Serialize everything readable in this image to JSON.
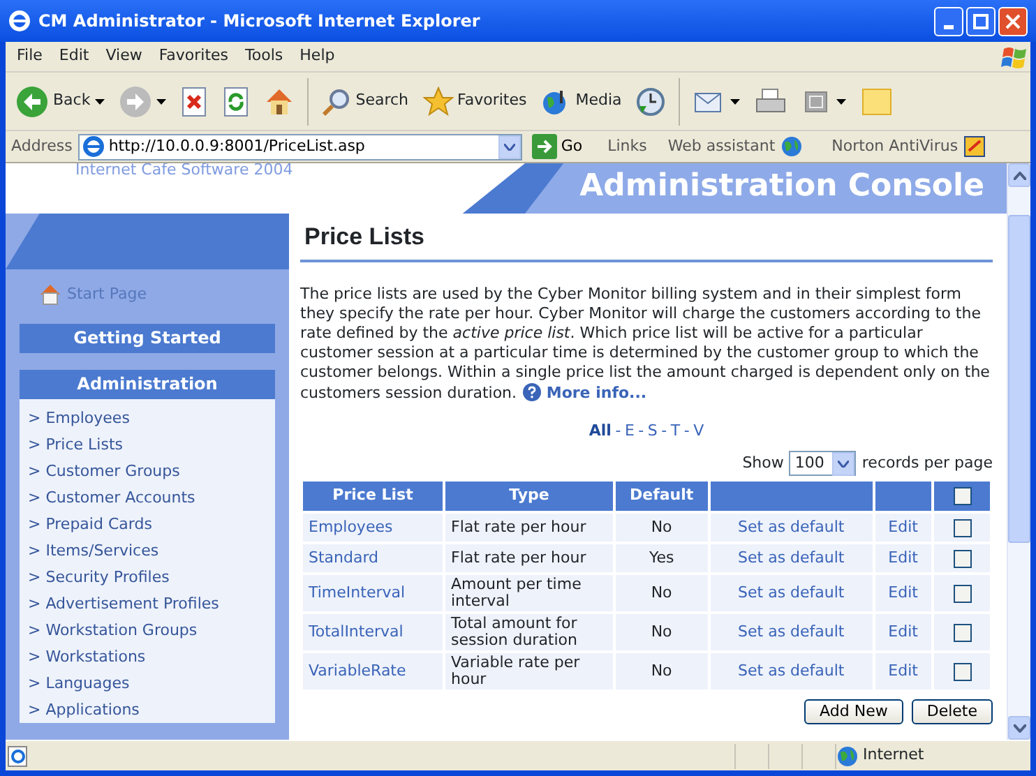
{
  "window": {
    "title": "CM Administrator - Microsoft Internet Explorer"
  },
  "menu_bar": [
    "File",
    "Edit",
    "View",
    "Favorites",
    "Tools",
    "Help"
  ],
  "toolbar": {
    "back": "Back",
    "search": "Search",
    "favorites": "Favorites",
    "media": "Media"
  },
  "address_bar": {
    "label": "Address",
    "url": "http://10.0.0.9:8001/PriceList.asp",
    "go": "Go",
    "links": "Links",
    "web_assistant": "Web assistant",
    "antivirus": "Norton AntiVirus"
  },
  "header": {
    "logo_caption": "Internet Cafe Software 2004",
    "title": "Administration Console"
  },
  "sidebar": {
    "start_page": "Start Page",
    "sections": [
      {
        "title": "Getting Started"
      },
      {
        "title": "Administration",
        "items": [
          "> Employees",
          "> Price Lists",
          "> Customer Groups",
          "> Customer Accounts",
          "> Prepaid Cards",
          "> Items/Services",
          "> Security Profiles",
          "> Advertisement Profiles",
          "> Workstation Groups",
          "> Workstations",
          "> Languages",
          "> Applications"
        ]
      }
    ]
  },
  "page": {
    "title": "Price Lists",
    "description": "The price lists are used by the Cyber Monitor billing system and in their simplest form they specify the rate per hour. Cyber Monitor will charge the customers according to the rate defined by the *active price list*. Which price list will be active for a particular customer session at a particular time is determined by the customer group to which the customer belongs. Within a single price list the amount charged is dependent only on the customers session duration.",
    "more_info": "More info...",
    "letter_filter": [
      {
        "label": "All",
        "selected": true
      },
      {
        "label": "E",
        "selected": false
      },
      {
        "label": "S",
        "selected": false
      },
      {
        "label": "T",
        "selected": false
      },
      {
        "label": "V",
        "selected": false
      }
    ],
    "filter_separator": "-",
    "show_label": "Show",
    "page_size": "100",
    "per_page_label": "records per page",
    "table": {
      "columns": [
        "Price List",
        "Type",
        "Default"
      ],
      "select_all_checked": false,
      "rows": [
        {
          "name": "Employees",
          "type": "Flat rate per hour",
          "default": "No",
          "set_default": "Set as default",
          "edit": "Edit",
          "checked": false
        },
        {
          "name": "Standard",
          "type": "Flat rate per hour",
          "default": "Yes",
          "set_default": "Set as default",
          "edit": "Edit",
          "checked": false
        },
        {
          "name": "TimeInterval",
          "type": "Amount per time interval",
          "default": "No",
          "set_default": "Set as default",
          "edit": "Edit",
          "checked": false
        },
        {
          "name": "TotalInterval",
          "type": "Total amount for session duration",
          "default": "No",
          "set_default": "Set as default",
          "edit": "Edit",
          "checked": false
        },
        {
          "name": "VariableRate",
          "type": "Variable rate per hour",
          "default": "No",
          "set_default": "Set as default",
          "edit": "Edit",
          "checked": false
        }
      ]
    },
    "buttons": [
      "Add New",
      "Delete"
    ]
  },
  "status_bar": {
    "zone": "Internet"
  }
}
